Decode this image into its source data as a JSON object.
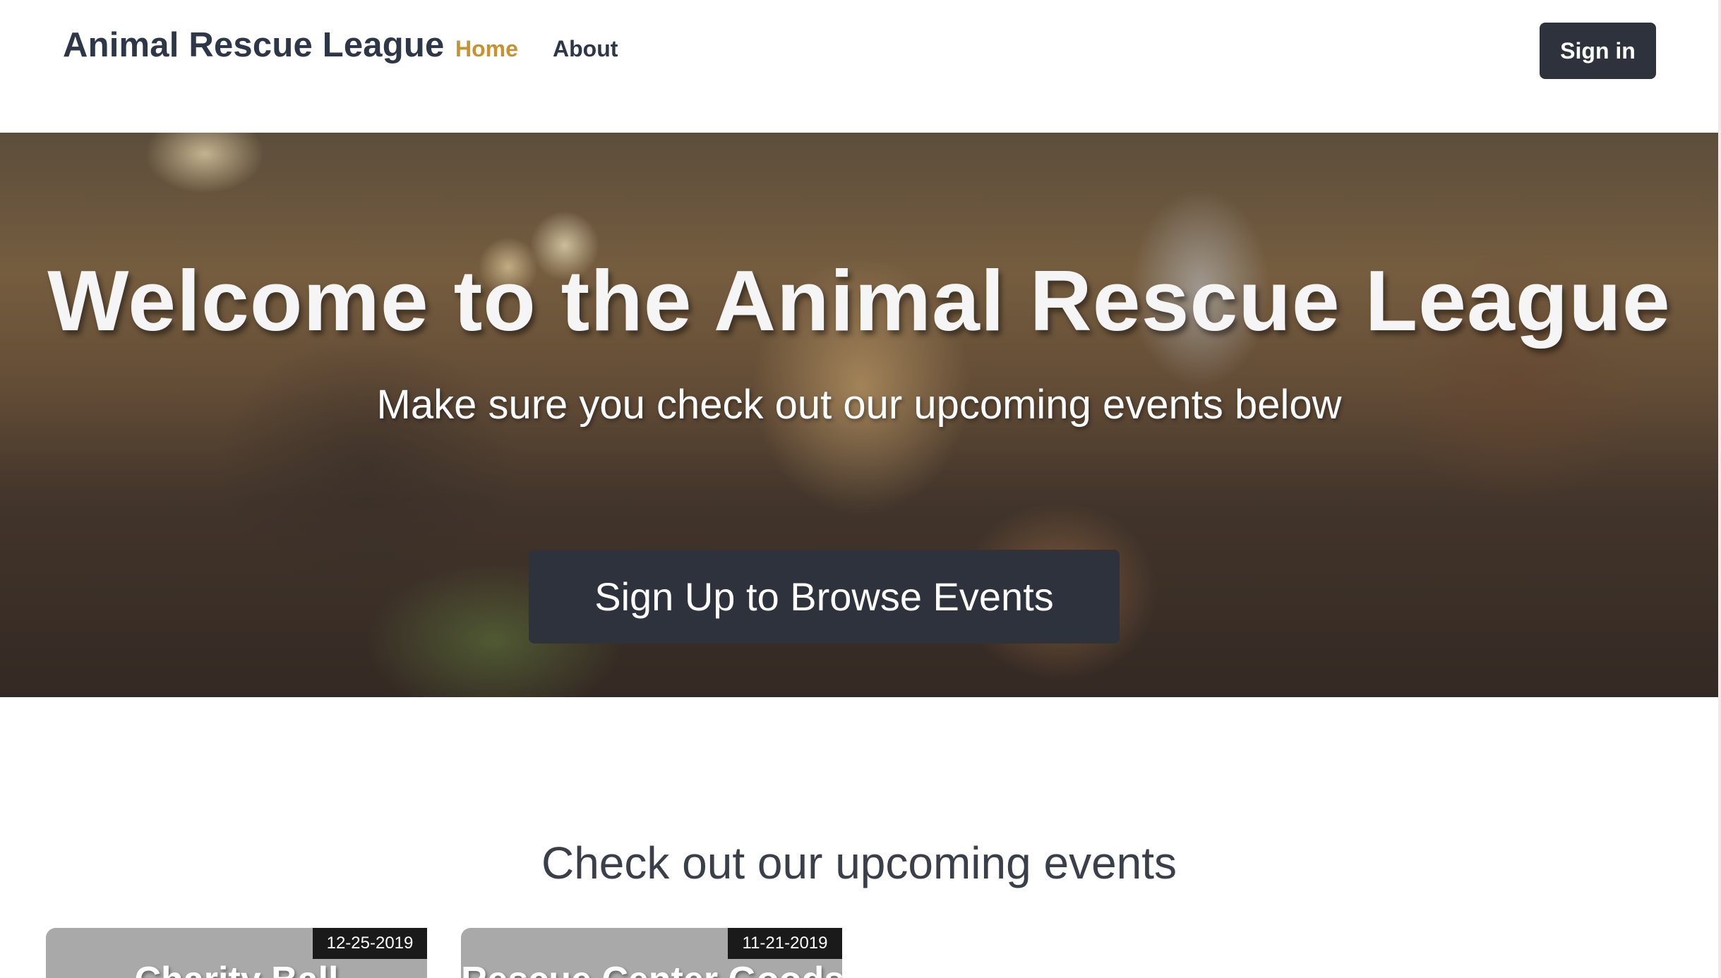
{
  "header": {
    "brand": "Animal Rescue League",
    "nav": {
      "home": "Home",
      "about": "About"
    },
    "sign_in": "Sign in",
    "active_color": "#c9922d"
  },
  "hero": {
    "title": "Welcome to the Animal Rescue League",
    "subtitle": "Make sure you check out our upcoming events below",
    "cta": "Sign Up to Browse Events",
    "image": "celebration-toast-photo"
  },
  "events": {
    "heading": "Check out our upcoming events",
    "cards": [
      {
        "date": "12-25-2019",
        "title": "Charity Ball"
      },
      {
        "date": "11-21-2019",
        "title": "Rescue Center Goods"
      }
    ]
  },
  "colors": {
    "button_bg": "#2d323c",
    "text_dark": "#2d3748",
    "card_bg": "#a9a9a9",
    "date_badge_bg": "#1a1a1a"
  }
}
